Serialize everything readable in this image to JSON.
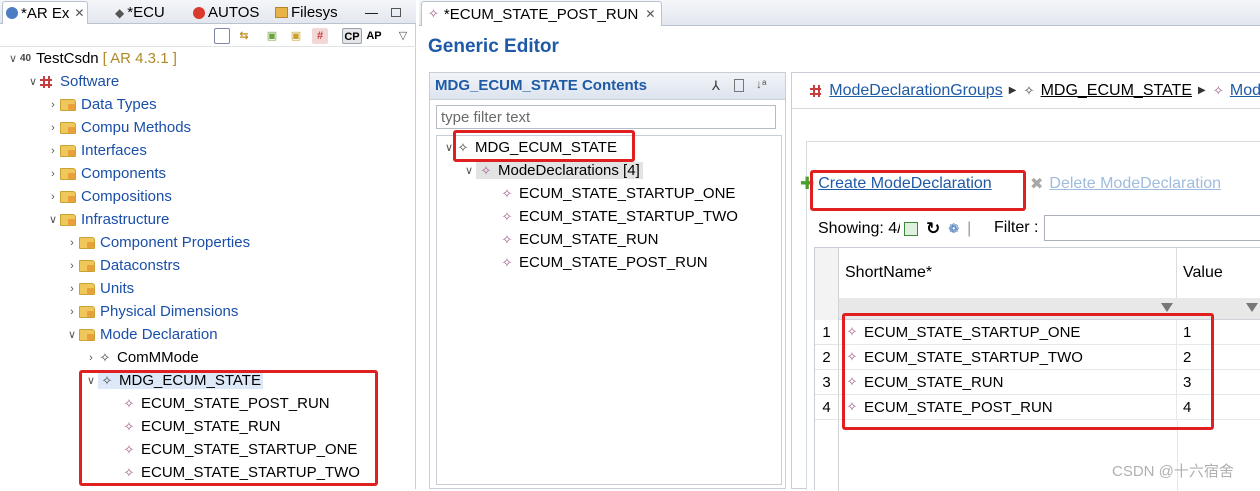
{
  "left_tabs": [
    {
      "label": "*AR Ex"
    },
    {
      "label": "*ECU"
    },
    {
      "label": "AUTOS"
    },
    {
      "label": "Filesys"
    }
  ],
  "left_toolbar": {
    "cp_label": "CP",
    "ap_label": "AP"
  },
  "project_tree": {
    "root_name": "TestCsdn",
    "root_version": "[ AR 4.3.1 ]",
    "software": "Software",
    "data_types": "Data Types",
    "compu_methods": "Compu Methods",
    "interfaces": "Interfaces",
    "components": "Components",
    "compositions": "Compositions",
    "infrastructure": "Infrastructure",
    "component_properties": "Component Properties",
    "dataconstrs": "Dataconstrs",
    "units": "Units",
    "physical_dimensions": "Physical Dimensions",
    "mode_declaration": "Mode Declaration",
    "commmode": "ComMMode",
    "mdg_ecum_state": "MDG_ECUM_STATE",
    "children": [
      "ECUM_STATE_POST_RUN",
      "ECUM_STATE_RUN",
      "ECUM_STATE_STARTUP_ONE",
      "ECUM_STATE_STARTUP_TWO"
    ]
  },
  "editor": {
    "tab_title": "*ECUM_STATE_POST_RUN",
    "title": "Generic Editor"
  },
  "contents": {
    "title": "MDG_ECUM_STATE Contents",
    "filter_placeholder": "type filter text",
    "root": "MDG_ECUM_STATE",
    "group": "ModeDeclarations [4]",
    "items": [
      "ECUM_STATE_STARTUP_ONE",
      "ECUM_STATE_STARTUP_TWO",
      "ECUM_STATE_RUN",
      "ECUM_STATE_POST_RUN"
    ]
  },
  "breadcrumb": {
    "first": "ModeDeclarationGroups",
    "second": "MDG_ECUM_STATE",
    "third": "Mod"
  },
  "actions": {
    "create": "Create ModeDeclaration",
    "delete": "Delete ModeDeclaration"
  },
  "showing": "Showing: 4/4",
  "filter_label": "Filter :",
  "table": {
    "columns": [
      "ShortName*",
      "Value"
    ],
    "rows": [
      {
        "num": "1",
        "name": "ECUM_STATE_STARTUP_ONE",
        "value": "1"
      },
      {
        "num": "2",
        "name": "ECUM_STATE_STARTUP_TWO",
        "value": "2"
      },
      {
        "num": "3",
        "name": "ECUM_STATE_RUN",
        "value": "3"
      },
      {
        "num": "4",
        "name": "ECUM_STATE_POST_RUN",
        "value": "4"
      }
    ]
  },
  "watermark": "CSDN @十六宿舍",
  "colors": {
    "highlight": "#e02020",
    "link": "#1f5aa6",
    "mode_icon": "#a15c8a"
  }
}
